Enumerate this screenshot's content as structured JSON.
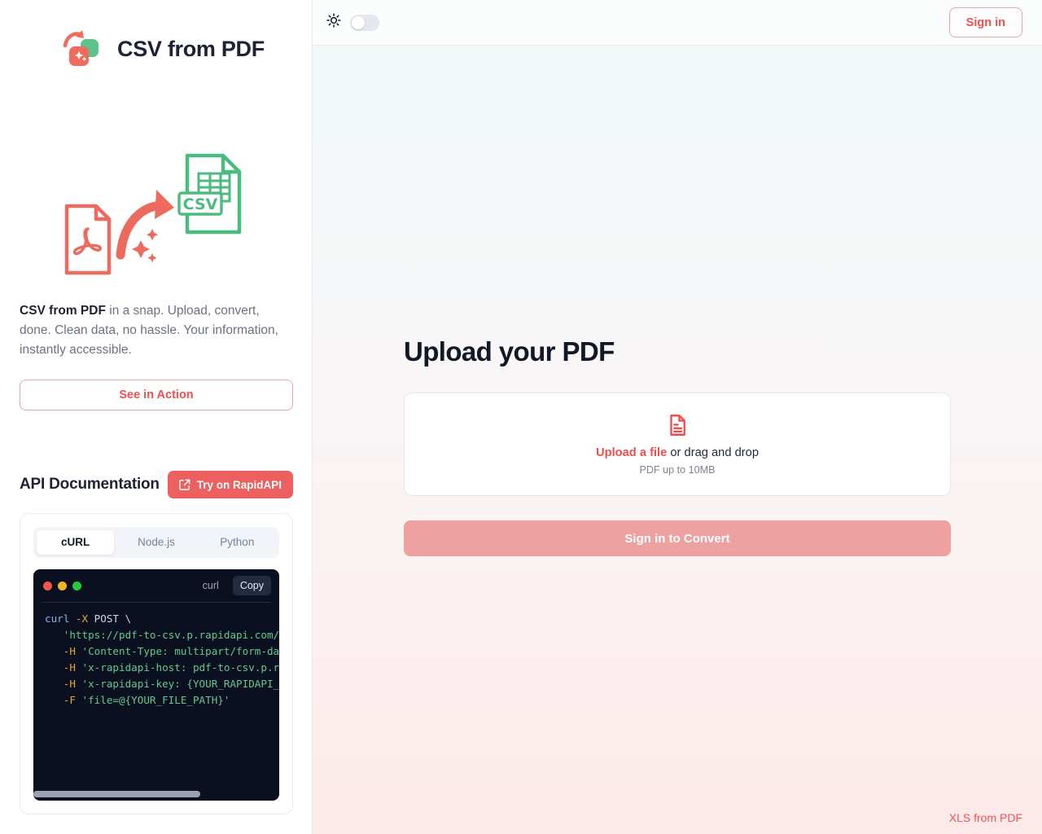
{
  "brand": {
    "title": "CSV from PDF",
    "logo_icon": "csv-from-pdf-logo-icon"
  },
  "sidebar": {
    "illustration_icon": "pdf-to-csv-illustration",
    "blurb_strong": "CSV from PDF",
    "blurb_rest": " in a snap. Upload, convert, done. Clean data, no hassle. Your information, instantly accessible.",
    "see_in_action_label": "See in Action",
    "api": {
      "title": "API Documentation",
      "rapidapi_label": "Try on RapidAPI",
      "rapidapi_icon": "external-link-icon",
      "tabs": [
        {
          "label": "cURL",
          "active": true
        },
        {
          "label": "Node.js",
          "active": false
        },
        {
          "label": "Python",
          "active": false
        }
      ],
      "terminal": {
        "lang_label": "curl",
        "copy_label": "Copy",
        "dots": [
          "red",
          "yellow",
          "green"
        ],
        "lines": [
          [
            {
              "t": "curl ",
              "c": "cmd"
            },
            {
              "t": "-X ",
              "c": "flag"
            },
            {
              "t": "POST \\",
              "c": "txt"
            }
          ],
          [
            {
              "t": "   ",
              "c": "txt"
            },
            {
              "t": "'https://pdf-to-csv.p.rapidapi.com/convert' \\",
              "c": "str"
            }
          ],
          [
            {
              "t": "   ",
              "c": "txt"
            },
            {
              "t": "-H ",
              "c": "flag"
            },
            {
              "t": "'Content-Type: multipart/form-data' \\",
              "c": "str"
            }
          ],
          [
            {
              "t": "   ",
              "c": "txt"
            },
            {
              "t": "-H ",
              "c": "flag"
            },
            {
              "t": "'x-rapidapi-host: pdf-to-csv.p.rapidapi.com' \\",
              "c": "str"
            }
          ],
          [
            {
              "t": "   ",
              "c": "txt"
            },
            {
              "t": "-H ",
              "c": "flag"
            },
            {
              "t": "'x-rapidapi-key: {YOUR_RAPIDAPI_KEY}' \\",
              "c": "str"
            }
          ],
          [
            {
              "t": "   ",
              "c": "txt"
            },
            {
              "t": "-F ",
              "c": "flag"
            },
            {
              "t": "'file=@{YOUR_FILE_PATH}'",
              "c": "str"
            }
          ]
        ]
      }
    }
  },
  "topbar": {
    "theme_icon": "sun-icon",
    "theme_toggle_state": "off",
    "signin_label": "Sign in"
  },
  "main": {
    "page_title": "Upload your PDF",
    "dropzone": {
      "icon": "document-upload-icon",
      "link_label": "Upload a file",
      "rest_label": " or drag and drop",
      "hint": "PDF up to 10MB"
    },
    "convert_button_label": "Sign in to Convert",
    "convert_button_disabled": true,
    "footer_link_label": "XLS from PDF"
  },
  "colors": {
    "accent_red": "#ef4f4f",
    "accent_green": "#4cbb7f",
    "title_dark": "#1e2235",
    "muted": "#6b7280",
    "terminal_bg": "#0b1020"
  }
}
